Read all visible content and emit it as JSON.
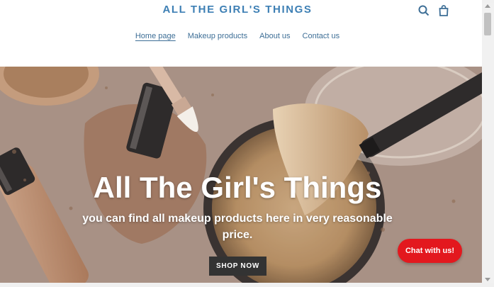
{
  "header": {
    "logo": "ALL THE GIRL'S THINGS",
    "search_icon": "search-icon",
    "cart_icon": "shopping-bag-icon"
  },
  "nav": {
    "items": [
      {
        "label": "Home page",
        "active": true
      },
      {
        "label": "Makeup products",
        "active": false
      },
      {
        "label": "About us",
        "active": false
      },
      {
        "label": "Contact us",
        "active": false
      }
    ]
  },
  "hero": {
    "title": "All The Girl's Things",
    "subtitle": "you can find all makeup products here in very reasonable price.",
    "cta": "SHOP NOW"
  },
  "chat": {
    "label": "Chat with us!"
  },
  "colors": {
    "brand": "#3d7fb4",
    "nav_link": "#3d6e96",
    "cta_bg": "#333333",
    "chat_bg": "#e3181e"
  }
}
